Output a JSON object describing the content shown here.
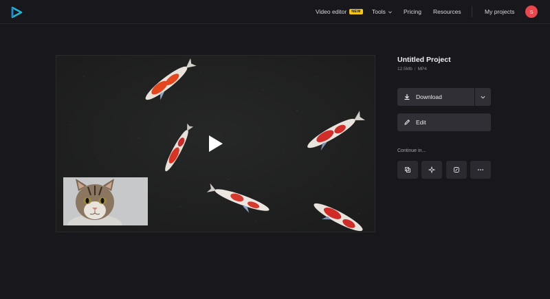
{
  "nav": {
    "video_editor": "Video editor",
    "new_badge": "NEW",
    "tools": "Tools",
    "pricing": "Pricing",
    "resources": "Resources",
    "my_projects": "My projects",
    "avatar_initial": "S"
  },
  "project": {
    "title": "Untitled Project",
    "size": "12.5Mb",
    "separator": "/",
    "format": "MP4"
  },
  "actions": {
    "download": "Download",
    "edit": "Edit",
    "continue_in": "Continue in..."
  },
  "icons": {
    "logo": "logo-play-icon",
    "download": "download-icon",
    "dropdown": "chevron-down-icon",
    "edit": "pencil-icon",
    "apps": [
      "duplicate-icon",
      "sparkle-icon",
      "enhance-icon",
      "more-icon"
    ],
    "play": "play-icon"
  },
  "colors": {
    "background": "#18181c",
    "button": "#2f2f35",
    "badge": "#f5c518",
    "avatar": "#e8474d",
    "logo_teal": "#1fb8d6"
  }
}
